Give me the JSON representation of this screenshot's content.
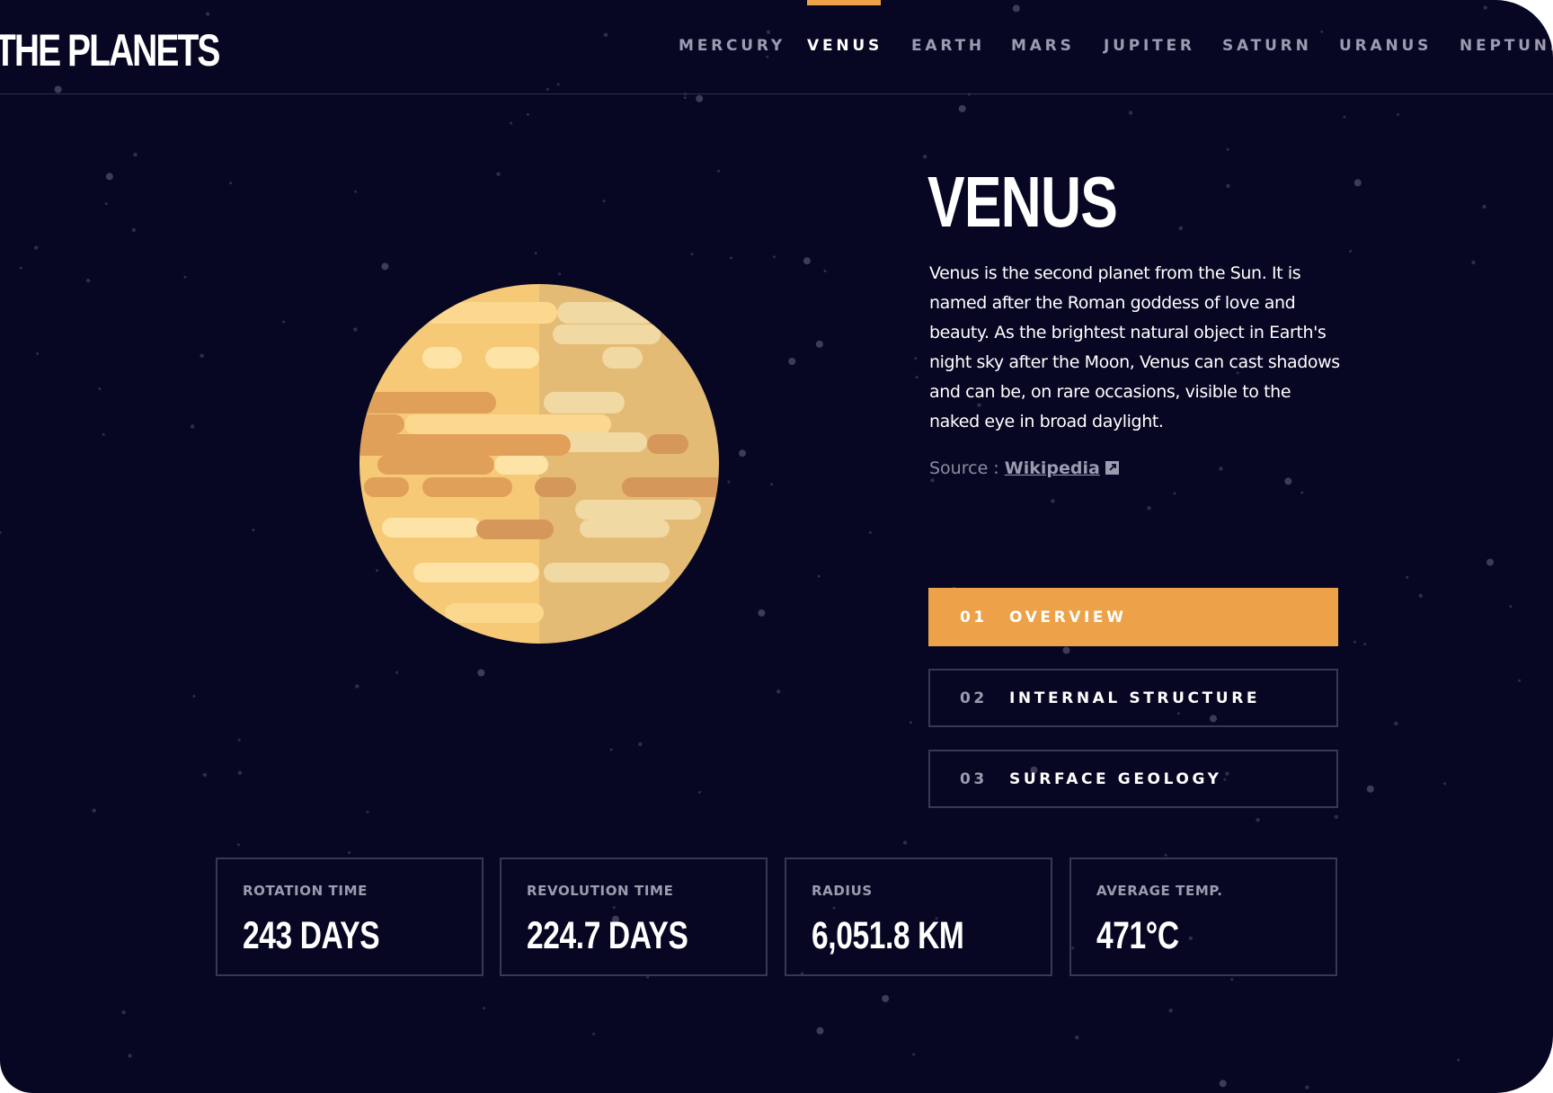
{
  "header": {
    "logo": "THE PLANETS",
    "nav": [
      {
        "label": "MERCURY"
      },
      {
        "label": "VENUS",
        "active": true
      },
      {
        "label": "EARTH"
      },
      {
        "label": "MARS"
      },
      {
        "label": "JUPITER"
      },
      {
        "label": "SATURN"
      },
      {
        "label": "URANUS"
      },
      {
        "label": "NEPTUNE"
      }
    ]
  },
  "planet": {
    "name": "VENUS",
    "description": "Venus is the second planet from the Sun. It is named after the Roman goddess of love and beauty. As the brightest natural object in Earth's night sky after the Moon, Venus can cast shadows and can be, on rare occasions, visible to the naked eye in broad daylight.",
    "source_prefix": "Source : ",
    "source_link": "Wikipedia",
    "source_icon": "external-link-icon"
  },
  "tabs": [
    {
      "num": "01",
      "label": "OVERVIEW",
      "active": true
    },
    {
      "num": "02",
      "label": "INTERNAL STRUCTURE"
    },
    {
      "num": "03",
      "label": "SURFACE GEOLOGY"
    }
  ],
  "stats": [
    {
      "label": "ROTATION TIME",
      "value": "243 DAYS"
    },
    {
      "label": "REVOLUTION TIME",
      "value": "224.7 DAYS"
    },
    {
      "label": "RADIUS",
      "value": "6,051.8 KM"
    },
    {
      "label": "AVERAGE TEMP.",
      "value": "471°C"
    }
  ],
  "colors": {
    "background": "#070724",
    "accent": "#eda249",
    "border": "#38384f",
    "muted_text": "#9c9cb0"
  }
}
